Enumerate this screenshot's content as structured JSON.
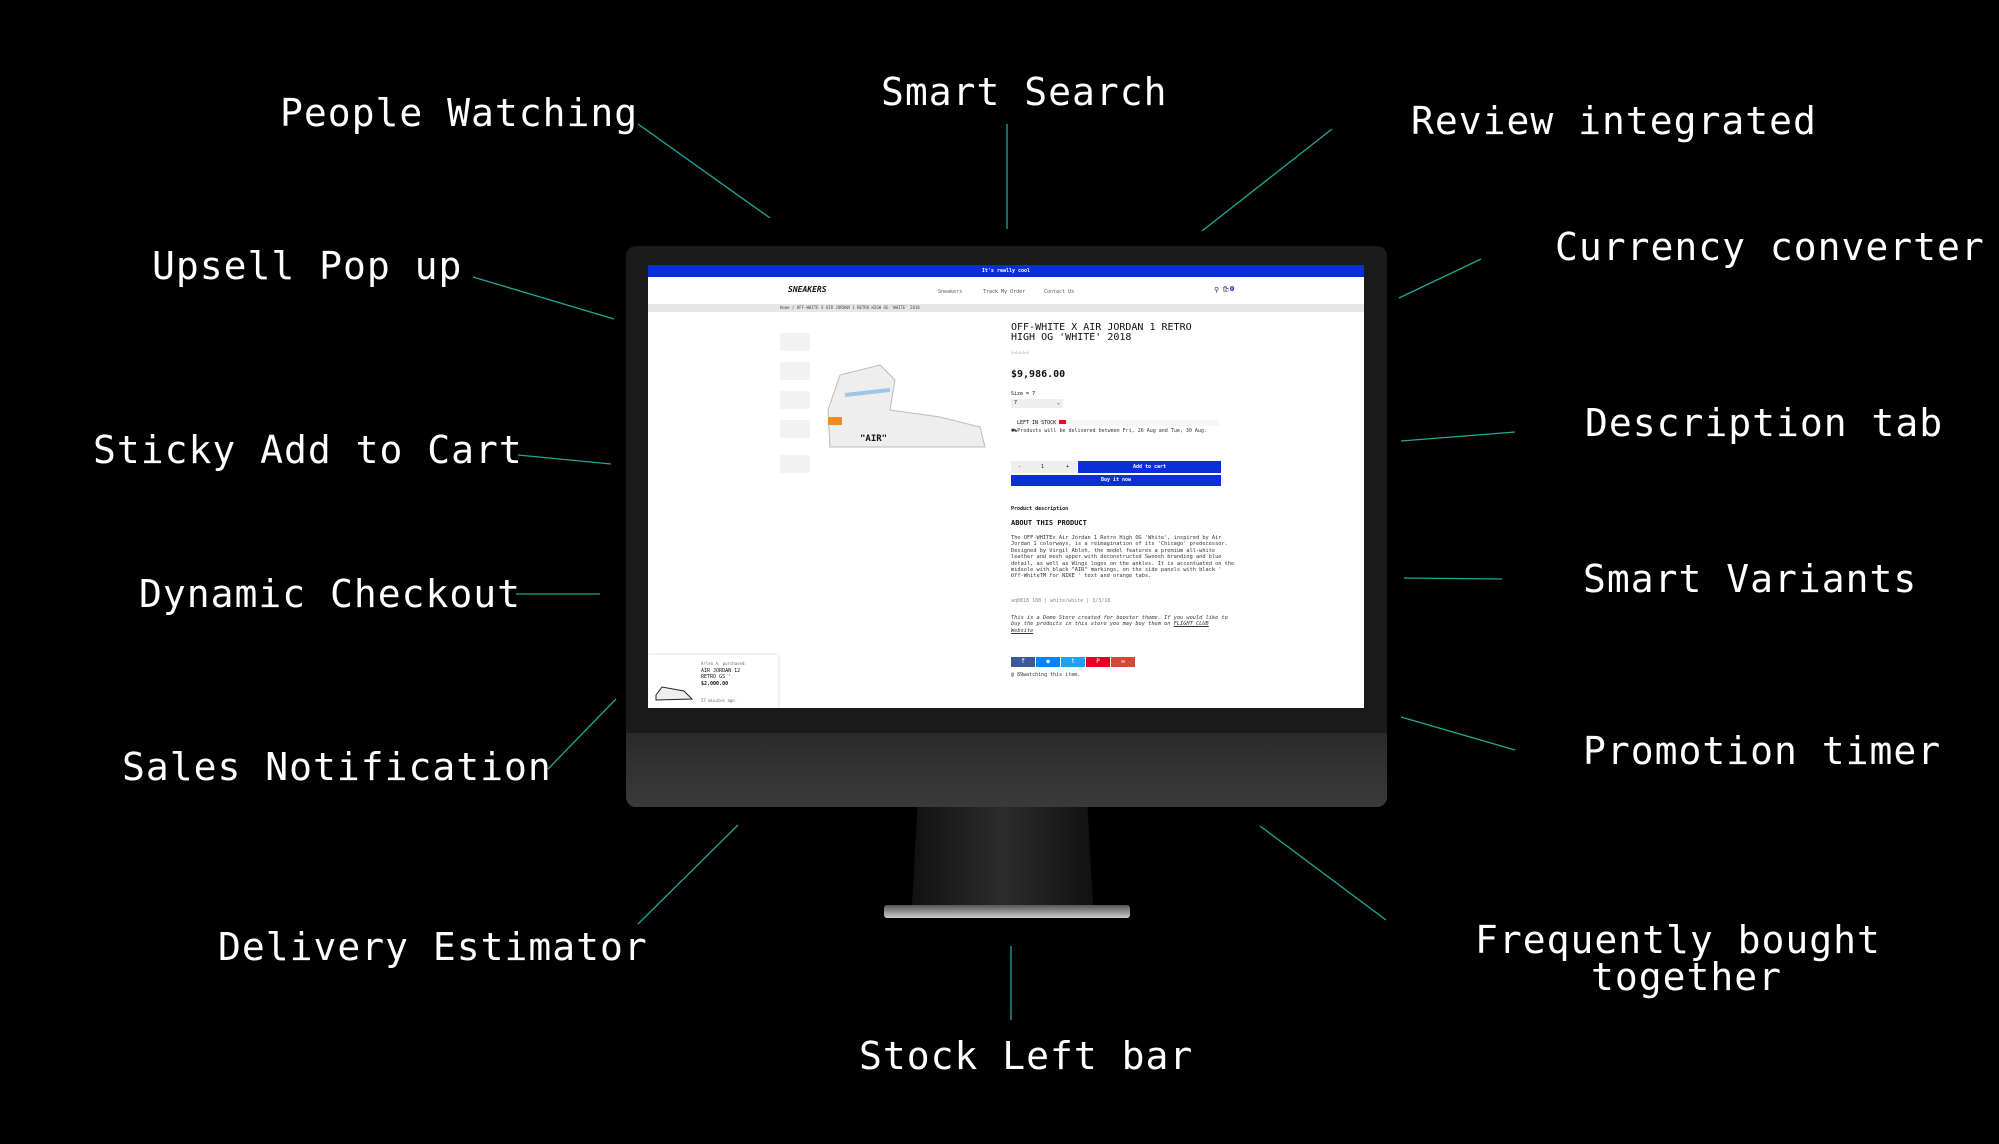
{
  "features": {
    "people_watching": "People Watching",
    "smart_search": "Smart Search",
    "review_integrated": "Review integrated",
    "upsell_popup": "Upsell Pop up",
    "currency_converter": "Currency converter",
    "sticky_add_to_cart": "Sticky Add to Cart",
    "description_tab": "Description tab",
    "dynamic_checkout": "Dynamic Checkout",
    "smart_variants": "Smart Variants",
    "sales_notification": "Sales Notification",
    "promotion_timer": "Promotion timer",
    "delivery_estimator": "Delivery Estimator",
    "frequently_bought_1": "Frequently bought",
    "frequently_bought_2": "together",
    "stock_left_bar": "Stock Left bar"
  },
  "store": {
    "banner": "It's really cool",
    "logo": "SNEAKERS",
    "nav": [
      "Sneakers",
      "Track My Order",
      "Contact Us"
    ],
    "cart_count": "0",
    "breadcrumb": "Home / OFF-WHITE X AIR JORDAN 1 RETRO HIGH OG 'WHITE' 2018",
    "product": {
      "title_1": "OFF-WHITE X AIR JORDAN 1 RETRO",
      "title_2": "HIGH OG 'WHITE' 2018",
      "stars": "☆☆☆☆☆",
      "price": "$9,986.00",
      "size_label": "Size = 7",
      "size_value": "7",
      "stock_label": "LEFT IN STOCK",
      "stock_color": "#e01020",
      "delivery": "Products will be delivered between Fri, 26 Aug and Tue, 30 Aug.",
      "qty_minus": "-",
      "qty": "1",
      "qty_plus": "+",
      "add_to_cart": "Add to cart",
      "buy_now": "Buy it now",
      "desc_tab": "Product description",
      "about_title": "ABOUT THIS PRODUCT",
      "about_text": "The OFF-WHITEx Air Jordan 1 Retro High OG 'White', inspired by Air Jordan 1 colorways, is a reimagination of its 'Chicago' predecessor. Designed by Virgil Abloh, the model features a premium all-white leather and mesh upper with deconstructed Swoosh branding and blue detail, as well as Wings logos on the ankles. It is accentuated on the midsole with black \"AIR\" markings, on the side panels with black ' Off-WhiteTM for NIKE ' text and orange tabs.",
      "sku": "aq0818 100 | white/white | 3/3/18",
      "demo_note": "This is a Demo Store created for booster theme. If you would like to buy the products in this store you may buy them on",
      "demo_link": "FLIGHT CLUB Website",
      "share": [
        {
          "icon": "facebook-icon",
          "glyph": "f",
          "color": "#3b5998"
        },
        {
          "icon": "messenger-icon",
          "glyph": "●",
          "color": "#0084ff"
        },
        {
          "icon": "twitter-icon",
          "glyph": "t",
          "color": "#1da1f2"
        },
        {
          "icon": "pinterest-icon",
          "glyph": "P",
          "color": "#e60023"
        },
        {
          "icon": "email-icon",
          "glyph": "✉",
          "color": "#d34836"
        }
      ],
      "watching": "@ 89watching this item.",
      "shoe_text": "\"AIR\""
    },
    "sales_popup": {
      "who": "Arlen A. purchased:",
      "item_1": "AIR JORDAN 12",
      "item_2": "RETRO GS '",
      "price": "$2,000.00",
      "time": "27 minutes ago."
    }
  },
  "accent": "#0a2fd6",
  "line_color": "#1fa89a"
}
